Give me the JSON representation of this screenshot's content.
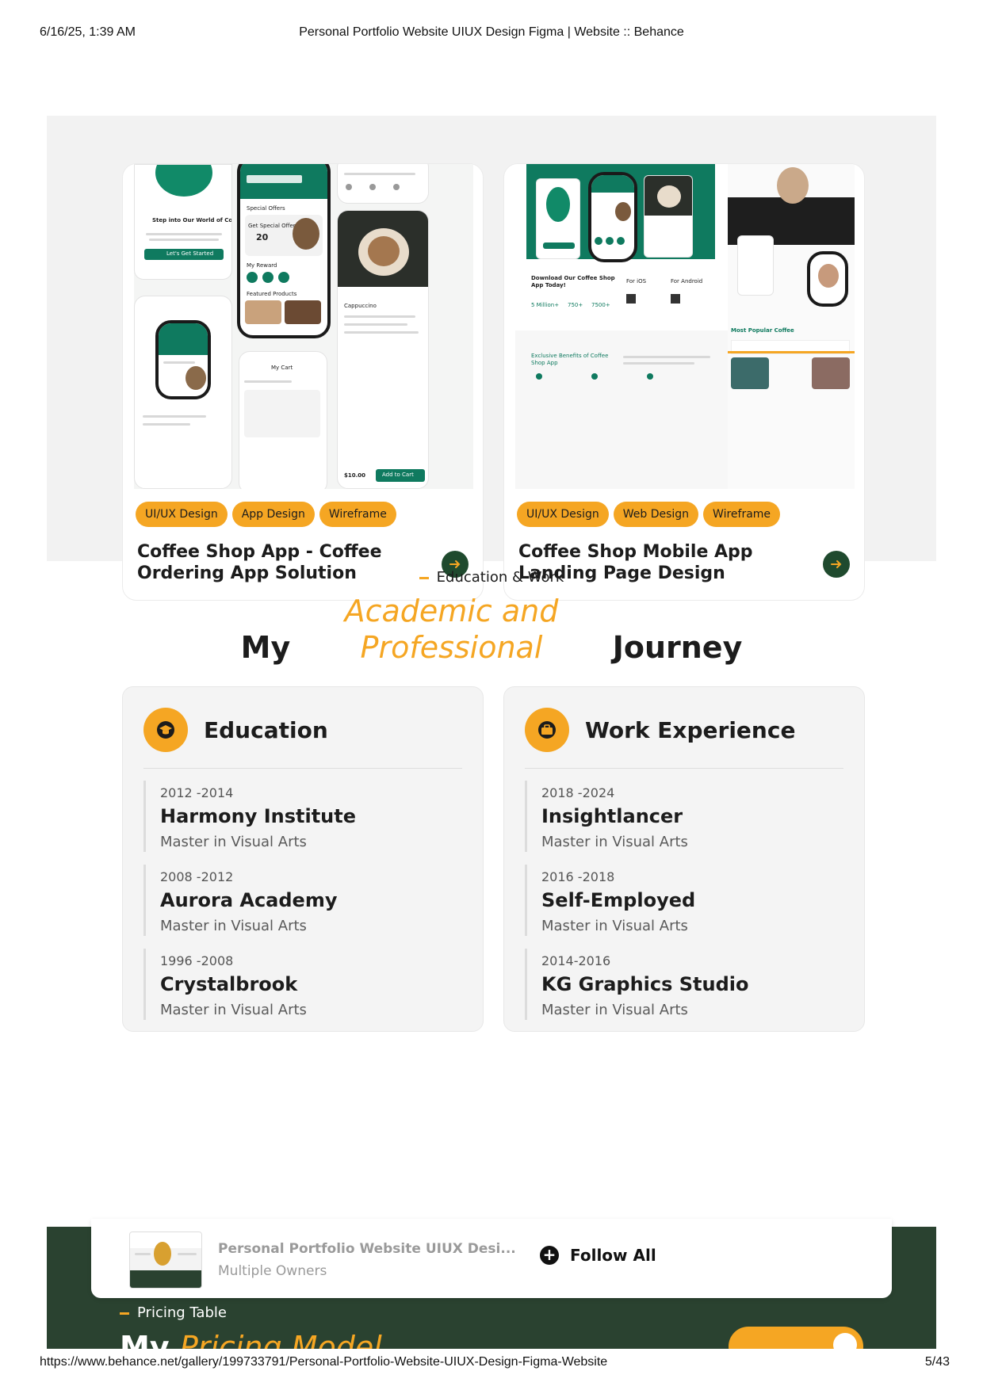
{
  "print": {
    "datetime": "6/16/25, 1:39 AM",
    "doc_title": "Personal Portfolio Website UIUX Design Figma | Website :: Behance",
    "url": "https://www.behance.net/gallery/199733791/Personal-Portfolio-Website-UIUX-Design-Figma-Website",
    "page": "5/43"
  },
  "colors": {
    "accent": "#f5a623",
    "brand_green": "#1f4a2e",
    "app_green": "#0f7a5f",
    "section_gray": "#f2f2f2"
  },
  "projects": [
    {
      "tags": [
        "UI/UX Design",
        "App Design",
        "Wireframe"
      ],
      "title": "Coffee Shop App - Coffee Ordering App Solution",
      "shot_text": {
        "welcome": "Step into Our World of Coffee Delight!",
        "cta": "Let's Get Started",
        "offers": "Special Offers",
        "offer": "Get Special Offer",
        "offer_val": "20",
        "reward": "My Reward",
        "featured": "Featured Products",
        "coffee": "Cappuccino",
        "cart": "My Cart",
        "add": "Add to Cart",
        "price": "$10.00"
      }
    },
    {
      "tags": [
        "UI/UX Design",
        "Web Design",
        "Wireframe"
      ],
      "title": "Coffee Shop Mobile App Landing Page Design",
      "shot_text": {
        "download": "Download Our Coffee Shop App Today!",
        "ios": "For iOS",
        "android": "For Android",
        "stat1": "5 Million+",
        "stat2": "750+",
        "stat3": "7500+",
        "benefits": "Exclusive Benefits of Coffee Shop App",
        "popular": "Most Popular Coffee"
      }
    }
  ],
  "journey": {
    "kicker": "Education & Work",
    "title_pre": "My",
    "title_acc": "Academic and Professional",
    "title_post": "Journey",
    "education": {
      "heading": "Education",
      "icon": "graduation-cap-icon",
      "items": [
        {
          "years": "2012 -2014",
          "org": "Harmony Institute",
          "degree": "Master in Visual Arts"
        },
        {
          "years": "2008 -2012",
          "org": "Aurora Academy",
          "degree": "Master in Visual Arts"
        },
        {
          "years": "1996 -2008",
          "org": "Crystalbrook",
          "degree": "Master in Visual Arts"
        }
      ]
    },
    "work": {
      "heading": "Work Experience",
      "icon": "briefcase-icon",
      "items": [
        {
          "years": "2018 -2024",
          "org": "Insightlancer",
          "degree": "Master in Visual Arts"
        },
        {
          "years": "2016 -2018",
          "org": "Self-Employed",
          "degree": "Master in Visual Arts"
        },
        {
          "years": "2014-2016",
          "org": "KG Graphics Studio",
          "degree": "Master in Visual Arts"
        }
      ]
    }
  },
  "sticky": {
    "project_name": "Personal Portfolio Website UIUX Desi...",
    "owners": "Multiple Owners",
    "follow_label": "Follow All"
  },
  "pricing": {
    "kicker": "Pricing Table",
    "title_pre": "My",
    "title_acc": "Pricing Model"
  }
}
